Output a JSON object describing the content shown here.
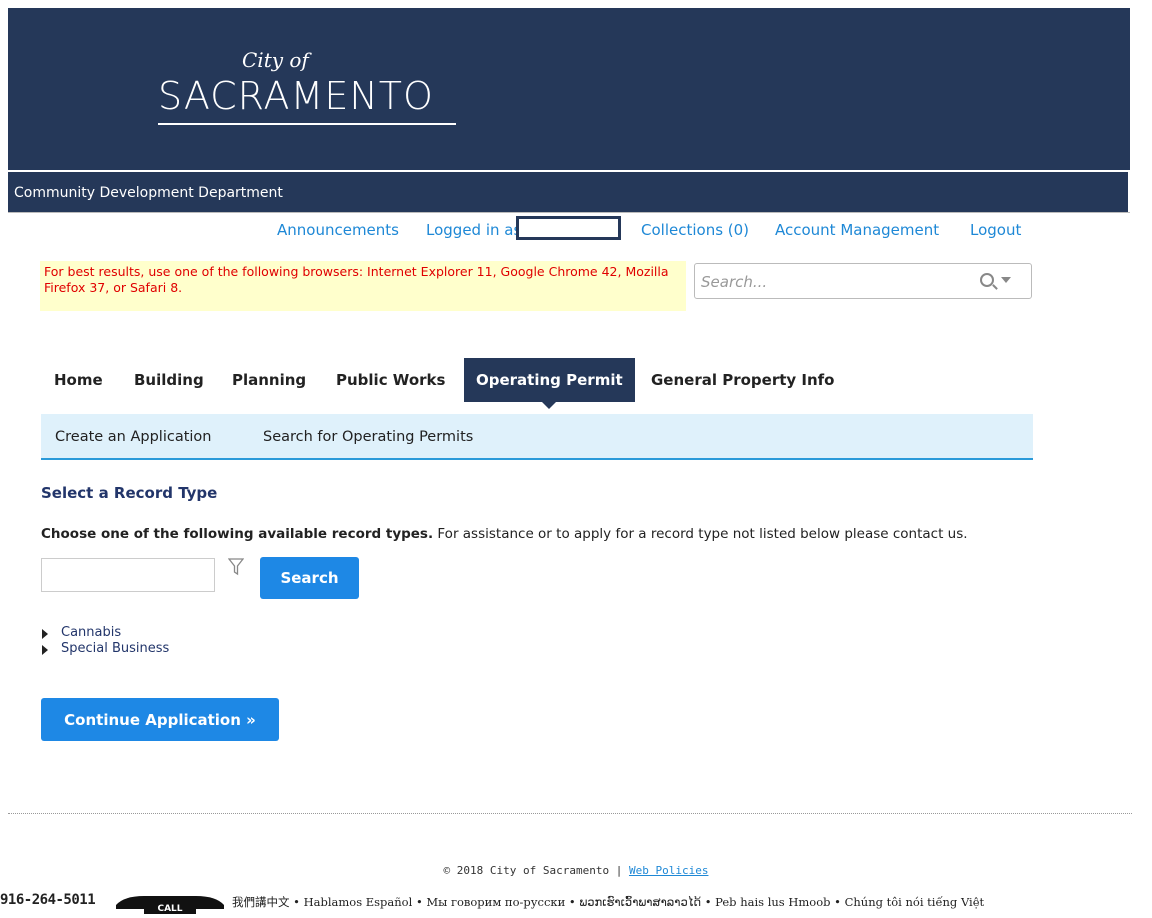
{
  "header": {
    "logo_city_of": "City of",
    "logo_name": "SACRAMENTO",
    "department": "Community Development Department"
  },
  "top_links": {
    "announcements": "Announcements",
    "logged_in_as": "Logged in as",
    "collections": "Collections (0)",
    "account_management": "Account Management",
    "logout": "Logout"
  },
  "notice": {
    "text": "For best results, use one of the following browsers: Internet Explorer 11, Google Chrome 42, Mozilla Firefox 37, or Safari 8."
  },
  "search": {
    "placeholder": "Search..."
  },
  "nav": {
    "tabs": [
      {
        "label": "Home"
      },
      {
        "label": "Building"
      },
      {
        "label": "Planning"
      },
      {
        "label": "Public Works"
      },
      {
        "label": "Operating Permit",
        "active": true
      },
      {
        "label": "General Property Info"
      }
    ],
    "subnav": [
      {
        "label": "Create an Application"
      },
      {
        "label": "Search for Operating Permits"
      }
    ]
  },
  "main": {
    "section_title": "Select a Record Type",
    "instructions_bold": "Choose one of the following available record types.",
    "instructions_rest": " For assistance or to apply for a record type not listed below please contact us.",
    "search_button": "Search",
    "record_types": [
      "Cannabis",
      "Special Business"
    ],
    "continue_button": "Continue Application »"
  },
  "footer": {
    "copyright": "© 2018 City of Sacramento |",
    "web_policies": "Web Policies",
    "phone": "916-264-5011",
    "call_label": "CALL",
    "languages": "我們講中文 • Hablamos Español • Мы говорим по-русски • ພວກເຮົາເວົ້າພາສາລາວໄດ້ • Peb hais lus Hmoob • Chúng tôi nói tiếng Việt"
  },
  "colors": {
    "header_bg": "#253859",
    "link": "#1e88d6",
    "button": "#1e88e5",
    "notice_bg": "#ffffcc",
    "notice_text": "#e00000",
    "subnav_bg": "#dff1fb"
  }
}
